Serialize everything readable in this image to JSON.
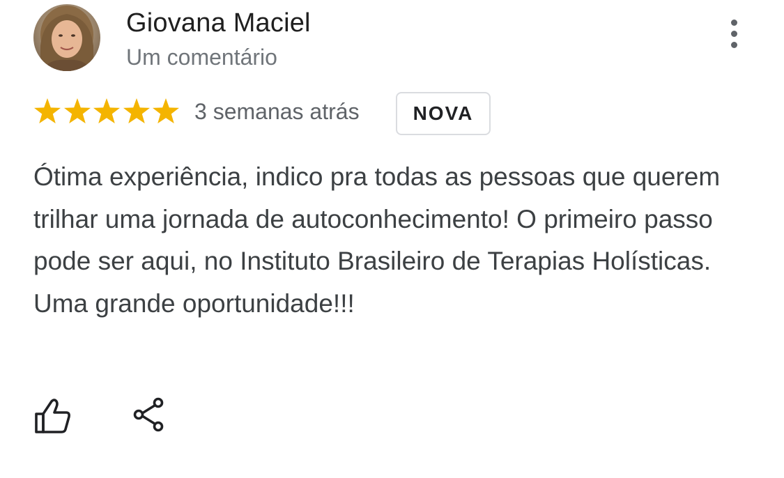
{
  "review": {
    "author_name": "Giovana Maciel",
    "author_meta": "Um comentário",
    "rating": 5,
    "rating_max": 5,
    "time_ago": "3 semanas atrás",
    "badge": "NOVA",
    "text": "Ótima experiência, indico pra todas as pessoas que querem trilhar uma jornada de autoconhecimento! O primeiro passo pode ser aqui, no Instituto Brasileiro de Terapias Holísticas. Uma grande oportunidade!!!"
  },
  "icons": {
    "menu": "more-vertical-icon",
    "star": "star-icon",
    "like": "thumbs-up-icon",
    "share": "share-icon"
  },
  "colors": {
    "star": "#f4b400",
    "name": "#1f1f1f",
    "meta": "#70757a",
    "body": "#3c4043",
    "badge_border": "#dadce0"
  }
}
